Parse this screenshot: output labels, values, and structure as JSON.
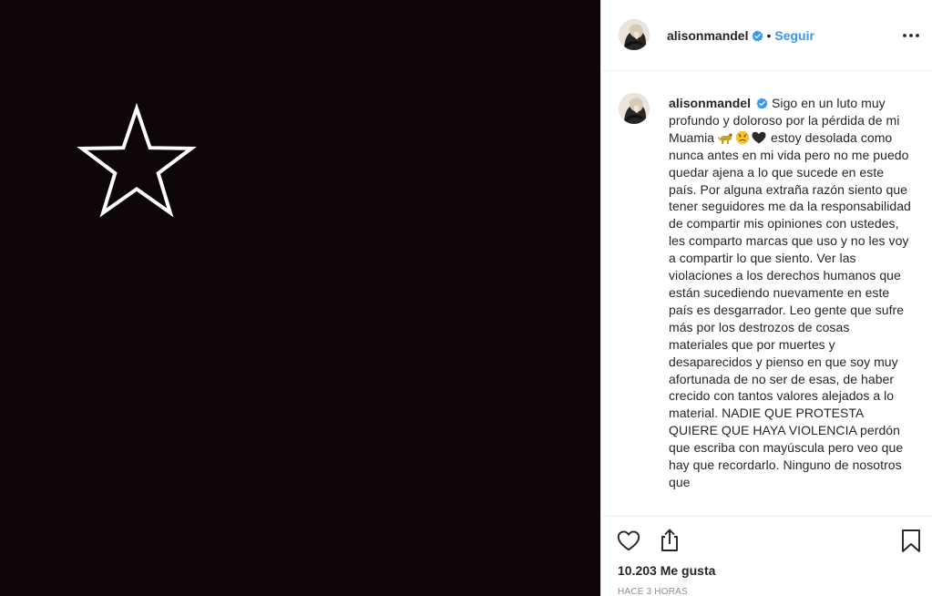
{
  "post": {
    "media": {
      "background_color": "#0d0506",
      "graphic": "star-outline-icon"
    },
    "header": {
      "username": "alisonmandel",
      "separator": "•",
      "follow_label": "Seguir",
      "options_icon": "more-options-icon"
    },
    "caption": {
      "username": "alisonmandel",
      "text_part1": "Sigo en un luto muy profundo y doloroso por la pérdida de mi Muamia",
      "text_part2": "estoy desolada como nunca antes en mi vida pero no me puedo quedar ajena a lo que sucede en este país. Por alguna extraña razón siento que tener seguidores me da la responsabilidad de compartir mis opiniones con ustedes, les comparto marcas que uso y no les voy a compartir lo que siento. Ver las violaciones a los derechos humanos que están sucediendo nuevamente en este país es desgarrador. Leo gente que sufre más por los destrozos de cosas materiales que por muertes y desaparecidos y pienso en que soy muy afortunada de no ser de esas, de haber crecido con tantos valores alejados a lo material. NADIE QUE PROTESTA QUIERE QUE HAYA VIOLENCIA perdón que escriba con mayúscula pero veo que hay que recordarlo. Ninguno de nosotros que",
      "emojis": [
        "dog-emoji",
        "sad-face-emoji",
        "black-heart-emoji"
      ]
    },
    "actions": {
      "like_icon": "heart-icon",
      "share_icon": "share-icon",
      "save_icon": "bookmark-icon"
    },
    "likes_text": "10.203 Me gusta",
    "time_text": "HACE 3 HORAS"
  },
  "colors": {
    "link": "#3897f0",
    "text": "#262626",
    "muted": "#8e8e8e",
    "verified": "#3897f0"
  }
}
